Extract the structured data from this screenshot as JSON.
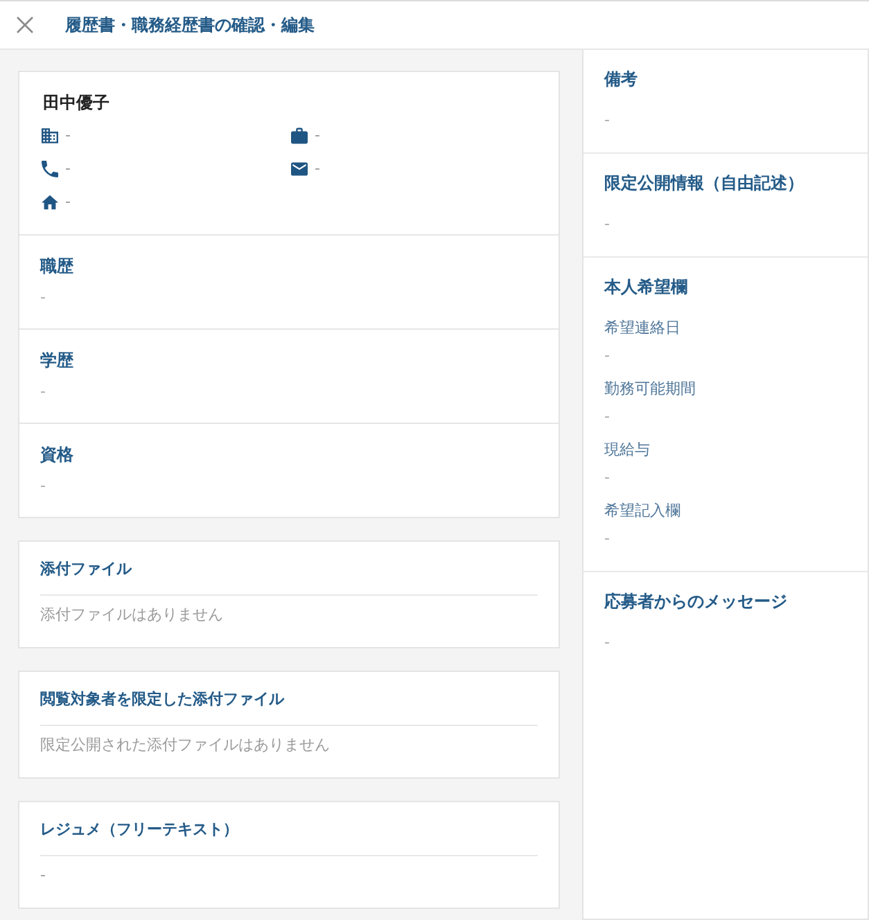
{
  "header": {
    "title": "履歴書・職務経歴書の確認・編集"
  },
  "profile": {
    "name": "田中優子",
    "contacts": [
      {
        "kind": "building",
        "value": "-"
      },
      {
        "kind": "briefcase",
        "value": "-"
      },
      {
        "kind": "phone",
        "value": "-"
      },
      {
        "kind": "mail",
        "value": "-"
      },
      {
        "kind": "home",
        "value": "-"
      }
    ],
    "sections": [
      {
        "heading": "職歴",
        "value": "-"
      },
      {
        "heading": "学歴",
        "value": "-"
      },
      {
        "heading": "資格",
        "value": "-"
      }
    ]
  },
  "attachment_cards": [
    {
      "title": "添付ファイル",
      "text": "添付ファイルはありません"
    },
    {
      "title": "閲覧対象者を限定した添付ファイル",
      "text": "限定公開された添付ファイルはありません"
    },
    {
      "title": "レジュメ（フリーテキスト）",
      "text": "-"
    }
  ],
  "side_panel": {
    "sections": [
      {
        "kind": "text",
        "heading": "備考",
        "value": "-"
      },
      {
        "kind": "text",
        "heading": "限定公開情報（自由記述）",
        "value": "-"
      },
      {
        "kind": "fields",
        "heading": "本人希望欄",
        "fields": [
          {
            "label": "希望連絡日",
            "value": "-"
          },
          {
            "label": "勤務可能期間",
            "value": "-"
          },
          {
            "label": "現給与",
            "value": "-"
          },
          {
            "label": "希望記入欄",
            "value": "-"
          }
        ]
      },
      {
        "kind": "text",
        "heading": "応募者からのメッセージ",
        "value": "-"
      }
    ]
  }
}
